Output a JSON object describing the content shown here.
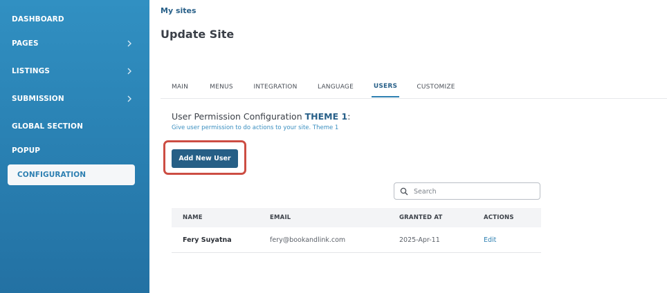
{
  "sidebar": {
    "items": [
      {
        "label": "DASHBOARD",
        "has_chevron": false
      },
      {
        "label": "PAGES",
        "has_chevron": true
      },
      {
        "label": "LISTINGS",
        "has_chevron": true
      },
      {
        "label": "SUBMISSION",
        "has_chevron": true
      },
      {
        "label": "GLOBAL SECTION",
        "has_chevron": false
      },
      {
        "label": "POPUP",
        "has_chevron": false
      },
      {
        "label": "CONFIGURATION",
        "has_chevron": false,
        "active": true
      }
    ]
  },
  "breadcrumb": "My sites",
  "page_title": "Update Site",
  "tabs": [
    {
      "label": "MAIN"
    },
    {
      "label": "MENUS"
    },
    {
      "label": "INTEGRATION"
    },
    {
      "label": "LANGUAGE"
    },
    {
      "label": "USERS",
      "active": true
    },
    {
      "label": "CUSTOMIZE"
    }
  ],
  "permission": {
    "title_prefix": "User Permission Configuration",
    "theme": "THEME 1",
    "title_suffix": ":",
    "subtitle": "Give user permission to do actions to your site. Theme 1"
  },
  "add_user_label": "Add New User",
  "search": {
    "placeholder": "Search",
    "value": ""
  },
  "table": {
    "headers": {
      "name": "NAME",
      "email": "EMAIL",
      "granted": "GRANTED AT",
      "actions": "ACTIONS"
    },
    "rows": [
      {
        "name": "Fery Suyatna",
        "email": "fery@bookandlink.com",
        "granted": "2025-Apr-11",
        "action": "Edit"
      }
    ]
  },
  "colors": {
    "sidebar": "#2a82b4",
    "accent": "#265f86",
    "highlight_border": "#cc4d43"
  }
}
